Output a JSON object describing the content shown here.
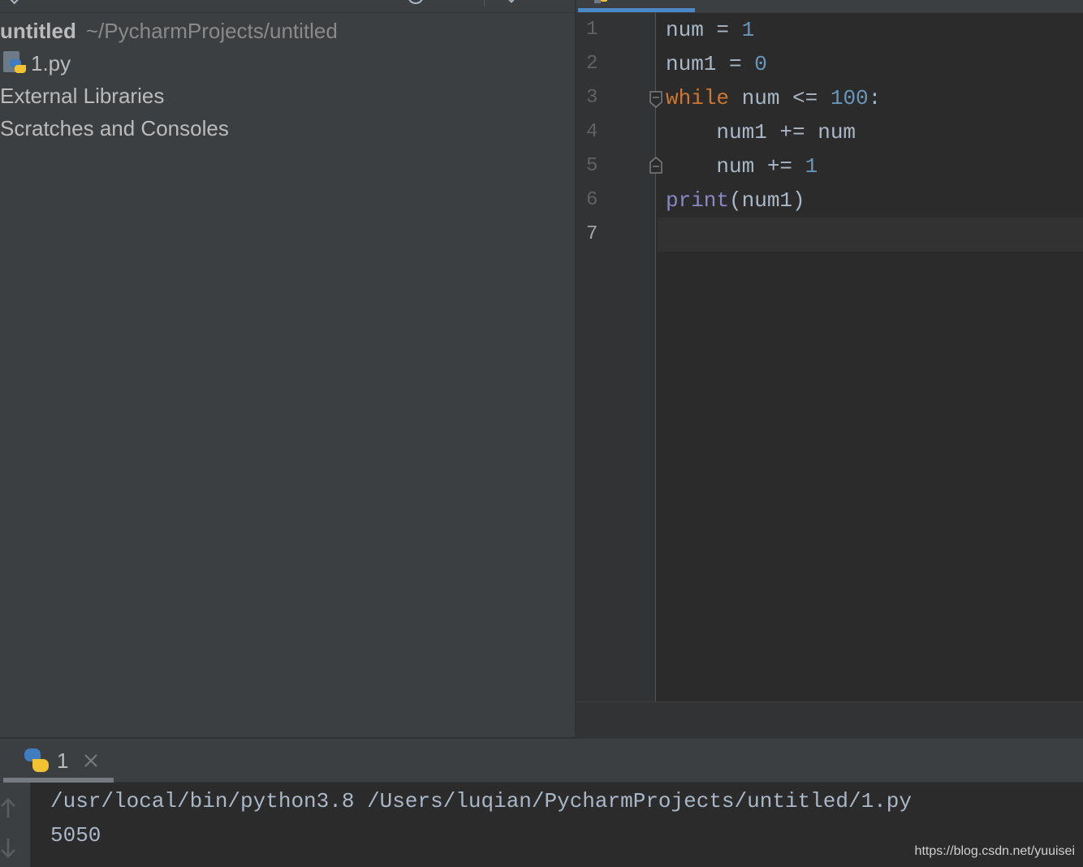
{
  "project": {
    "root_name": "untitled",
    "root_path": "~/PycharmProjects/untitled",
    "items": [
      {
        "label": "1.py",
        "icon": "python-file-icon"
      },
      {
        "label": "External Libraries"
      },
      {
        "label": "Scratches and Consoles"
      }
    ]
  },
  "editor": {
    "line_numbers": [
      "1",
      "2",
      "3",
      "4",
      "5",
      "6",
      "7"
    ],
    "current_line": "7"
  },
  "run": {
    "tab_label": "1",
    "tab_icon": "python-icon",
    "command": "/usr/local/bin/python3.8 /Users/luqian/PycharmProjects/untitled/1.py",
    "output": "5050"
  },
  "watermark": "https://blog.csdn.net/yuuisei",
  "colors": {
    "panel_bg": "#3c3f41",
    "editor_bg": "#2b2b2b",
    "keyword": "#cc7832",
    "number": "#6897bb",
    "builtin": "#8888c6",
    "text": "#a9b7c6",
    "tab_accent": "#4a88c7"
  }
}
